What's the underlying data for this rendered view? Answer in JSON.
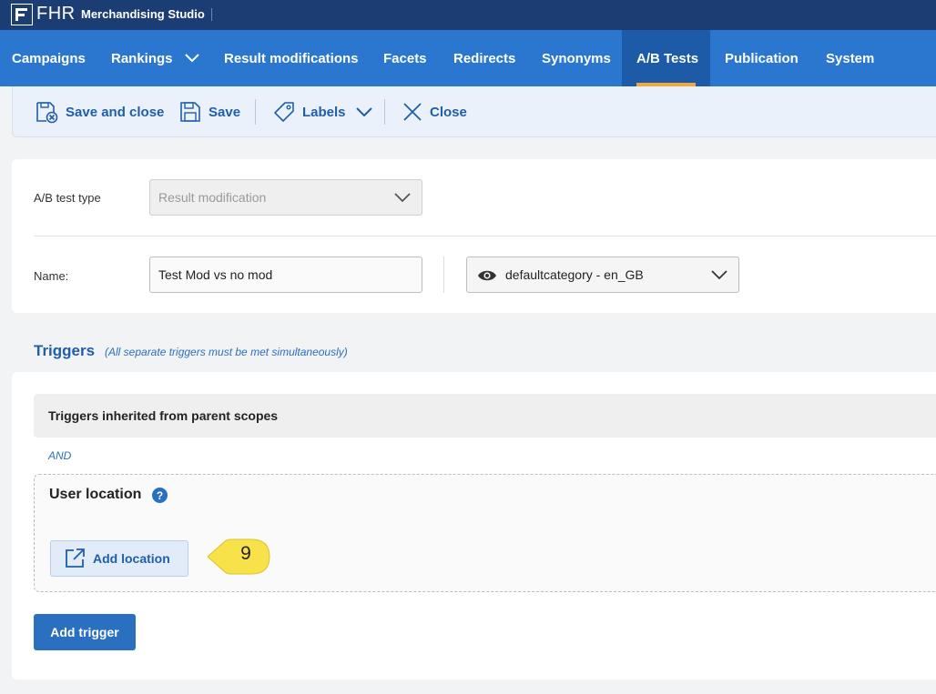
{
  "app": {
    "logo": "FHR",
    "name": "Merchandising Studio"
  },
  "nav": {
    "items": [
      "Campaigns",
      "Rankings",
      "Result modifications",
      "Facets",
      "Redirects",
      "Synonyms",
      "A/B Tests",
      "Publication",
      "System"
    ],
    "active": "A/B Tests"
  },
  "toolbar": {
    "save_close": "Save and close",
    "save": "Save",
    "labels": "Labels",
    "close": "Close"
  },
  "form": {
    "type_label": "A/B test type",
    "type_value": "Result modification",
    "name_label": "Name:",
    "name_value": "Test Mod vs no mod",
    "scope_value": "defaultcategory - en_GB"
  },
  "triggers": {
    "title": "Triggers",
    "note": "(All separate triggers must be met simultaneously)",
    "inherited": "Triggers inherited from parent scopes",
    "and": "AND",
    "location_title": "User location",
    "help": "?",
    "add_location": "Add location",
    "add_trigger": "Add trigger"
  },
  "callout": {
    "number": "9",
    "color": "#f7e24a"
  },
  "colors": {
    "topbar": "#1c3d73",
    "nav": "#2b77d0",
    "accent": "#f2a83b",
    "primary": "#2b6fc0"
  }
}
